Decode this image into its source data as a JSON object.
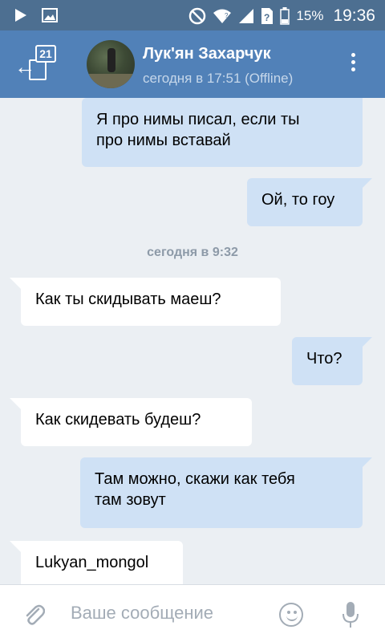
{
  "status_bar": {
    "battery_percent": "15%",
    "time": "19:36",
    "icons": [
      "play-icon",
      "image-icon",
      "do-not-disturb-icon",
      "wifi-icon",
      "signal-icon",
      "no-sim-icon",
      "battery-icon"
    ]
  },
  "header": {
    "unread_count": "21",
    "contact_name": "Лук'ян Захарчук",
    "contact_status": "сегодня в 17:51 (Offline)"
  },
  "messages": [
    {
      "direction": "out",
      "lines": [
        "Я про нимы писал, если ты",
        "про нимы вставай"
      ]
    },
    {
      "direction": "out",
      "lines": [
        "Ой, то гоу"
      ]
    },
    {
      "type": "date",
      "text": "сегодня в 9:32"
    },
    {
      "direction": "in",
      "lines": [
        "Как ты скидывать маеш?"
      ]
    },
    {
      "direction": "out",
      "lines": [
        "Что?"
      ]
    },
    {
      "direction": "in",
      "lines": [
        "Как скидевать будеш?"
      ]
    },
    {
      "direction": "out",
      "lines": [
        "Там можно, скажи как тебя",
        "там зовут"
      ]
    },
    {
      "direction": "in",
      "lines": [
        "Lukyan_mongol"
      ]
    }
  ],
  "composer": {
    "placeholder": "Ваше сообщение"
  },
  "colors": {
    "status_bar": "#4d6f91",
    "header": "#5181b8",
    "background": "#ebeff3",
    "outgoing_bubble": "#cfe1f5",
    "incoming_bubble": "#ffffff"
  }
}
